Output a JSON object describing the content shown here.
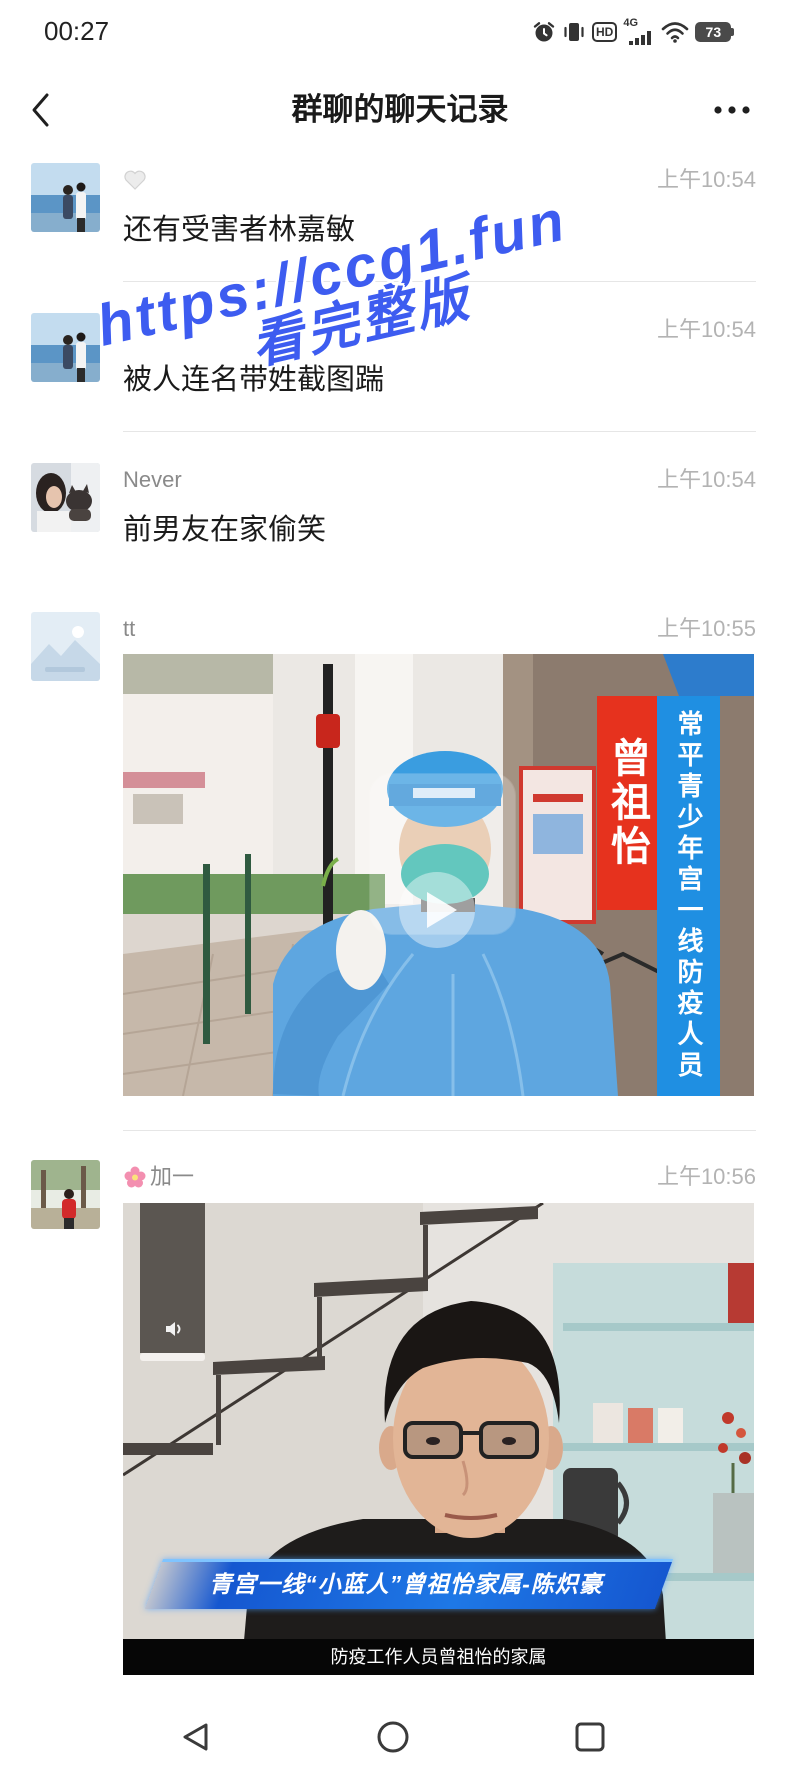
{
  "status_bar": {
    "time": "00:27",
    "icons": [
      "alarm-clock-icon",
      "vibrate-icon",
      "hd-icon",
      "signal-icon",
      "wifi-icon",
      "battery-icon"
    ],
    "hd_label": "HD",
    "network_label": "4G",
    "battery_level": "73"
  },
  "header": {
    "title": "群聊的聊天记录",
    "back_icon": "chevron-left-icon",
    "more_icon": "more-dots-icon"
  },
  "messages": [
    {
      "name_icon": "white-heart-icon",
      "time": "上午10:54",
      "text": "还有受害者林嘉敏"
    },
    {
      "time": "上午10:54",
      "text": "被人连名带姓截图踹"
    },
    {
      "name": "Never",
      "time": "上午10:54",
      "text": "前男友在家偷笑"
    },
    {
      "name": "tt",
      "time": "上午10:55",
      "video": {
        "play_icon": "play-icon",
        "red_caption": "曾祖怡",
        "blue_caption": "常平青少年宫一线防疫人员"
      }
    },
    {
      "name_icon": "pink-flower-icon",
      "name": "加一",
      "time": "上午10:56",
      "video": {
        "mute_icon": "speaker-icon",
        "banner": "青宫一线“小蓝人”曾祖怡家属-陈炽豪",
        "subtitle": "防疫工作人员曾祖怡的家属"
      }
    }
  ],
  "watermark": {
    "line1": "https://ccg1.fun",
    "line2": "看完整版"
  },
  "nav_bar": {
    "icons": [
      "back-triangle-icon",
      "home-circle-icon",
      "recent-apps-square-icon"
    ]
  },
  "colors": {
    "text": "#1a1a1a",
    "time_gray": "#b3b3b3",
    "name_gray": "#8a8a8a",
    "caption_red": "#e6321e",
    "caption_blue": "#1f8fe2",
    "banner_blue": "#1557d0",
    "watermark_blue": "#3d5cf0"
  }
}
